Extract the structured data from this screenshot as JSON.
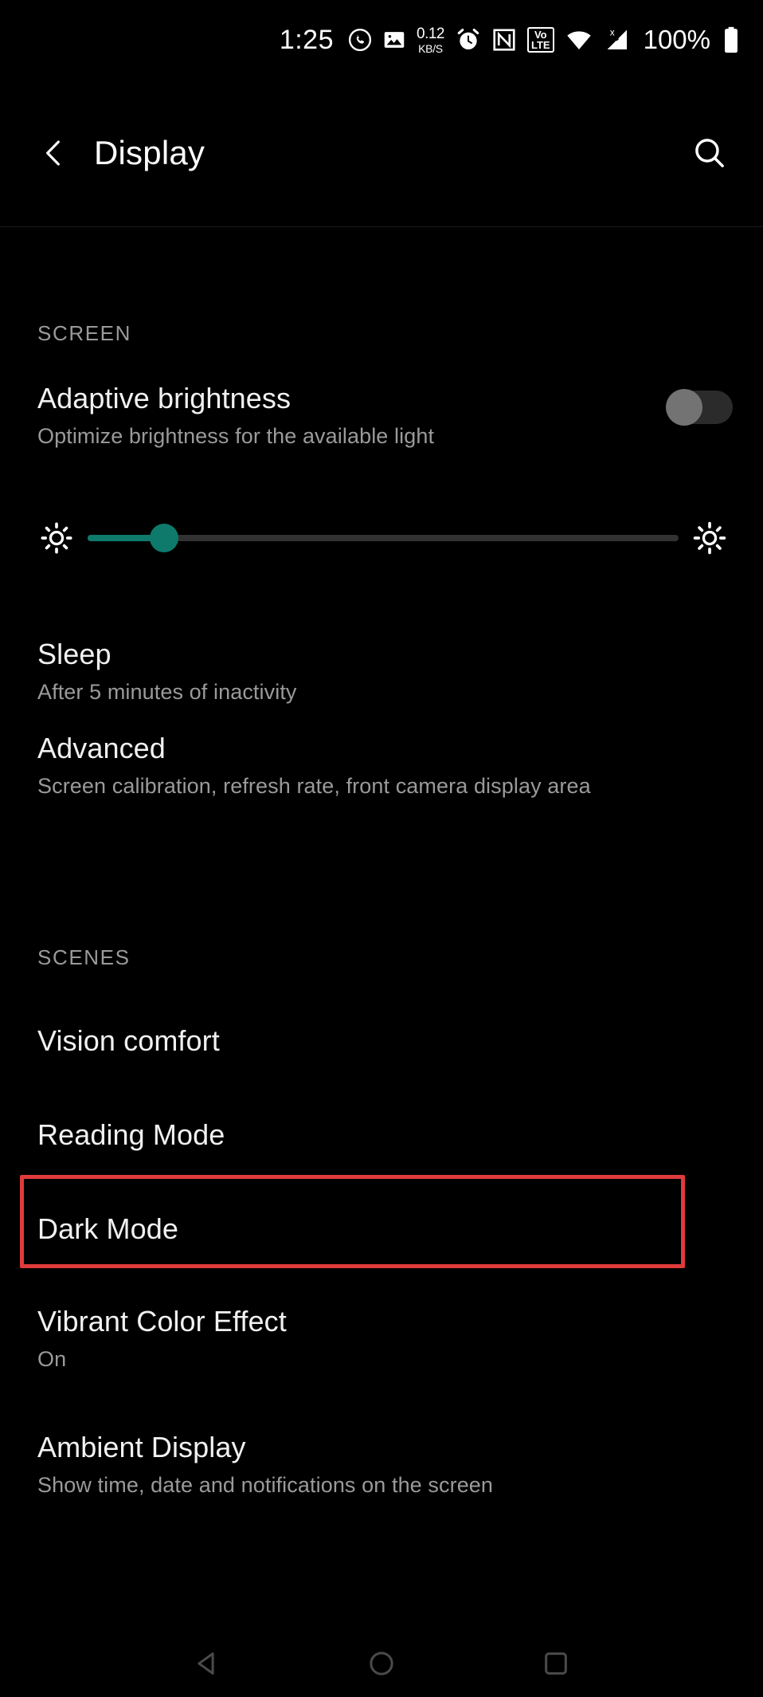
{
  "status_bar": {
    "time": "1:25",
    "icons": [
      {
        "name": "whatsapp-icon",
        "label": "WhatsApp"
      },
      {
        "name": "image-icon",
        "label": "Screenshot"
      }
    ],
    "network_speed": {
      "value": "0.12",
      "unit": "KB/S"
    },
    "alarm": "alarm-icon",
    "nfc": "nfc-icon",
    "volte": {
      "top": "Vo",
      "bottom": "LTE"
    },
    "wifi": "wifi-icon",
    "signal": "signal-no-sim-icon",
    "battery_percent": "100%",
    "battery": "battery-full-icon"
  },
  "app_bar": {
    "back": "back-arrow-icon",
    "title": "Display",
    "search": "search-icon"
  },
  "colors": {
    "accent_teal": "#0d7a6c",
    "highlight_red": "#e03b3b",
    "background": "#000000",
    "secondary_text": "#9a9a9a"
  },
  "sections": [
    {
      "header": "SCREEN",
      "rows": [
        {
          "title": "Adaptive brightness",
          "subtitle": "Optimize brightness for the available light",
          "control": "toggle",
          "toggle_on": false
        },
        {
          "control": "slider",
          "left_icon": "brightness-low-icon",
          "right_icon": "brightness-high-icon",
          "value_percent": 13
        },
        {
          "title": "Sleep",
          "subtitle": "After 5 minutes of inactivity"
        },
        {
          "title": "Advanced",
          "subtitle": "Screen calibration, refresh rate, front camera display area"
        }
      ]
    },
    {
      "header": "SCENES",
      "rows": [
        {
          "title": "Vision comfort",
          "subtitle": ""
        },
        {
          "title": "Reading Mode",
          "subtitle": ""
        },
        {
          "title": "Dark Mode",
          "subtitle": "",
          "highlighted": true
        },
        {
          "title": "Vibrant Color Effect",
          "subtitle": "On"
        },
        {
          "title": "Ambient Display",
          "subtitle": "Show time, date and notifications on the screen"
        }
      ]
    }
  ],
  "nav_bar": {
    "back": "nav-back-triangle-icon",
    "home": "nav-home-circle-icon",
    "recents": "nav-recents-square-icon"
  }
}
